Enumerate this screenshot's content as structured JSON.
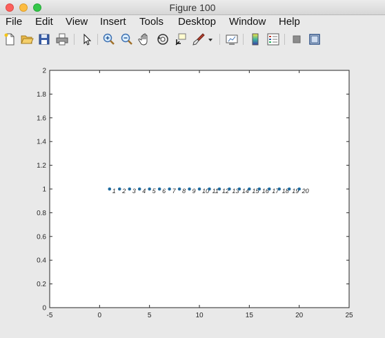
{
  "window": {
    "title": "Figure 100"
  },
  "menu": {
    "items": [
      "File",
      "Edit",
      "View",
      "Insert",
      "Tools",
      "Desktop",
      "Window",
      "Help"
    ]
  },
  "toolbar": {
    "icons": [
      "new-figure-icon",
      "open-file-icon",
      "save-icon",
      "print-icon",
      "pointer-icon",
      "zoom-in-icon",
      "zoom-out-icon",
      "pan-icon",
      "rotate-3d-icon",
      "data-cursor-icon",
      "brush-icon",
      "brush-dropdown-icon",
      "link-plot-icon",
      "colorbar-icon",
      "legend-icon",
      "hide-plot-tools-icon",
      "show-plot-tools-icon"
    ]
  },
  "colors": {
    "marker": "#1f6ba0",
    "axes_background": "#ffffff",
    "figure_background": "#e9e9e9"
  },
  "chart_data": {
    "type": "scatter",
    "title": "",
    "xlabel": "",
    "ylabel": "",
    "xlim": [
      -5,
      25
    ],
    "ylim": [
      0,
      2
    ],
    "xticks": [
      "-5",
      "0",
      "5",
      "10",
      "15",
      "20",
      "25"
    ],
    "yticks": [
      "0",
      "0.2",
      "0.4",
      "0.6",
      "0.8",
      "1",
      "1.2",
      "1.4",
      "1.6",
      "1.8",
      "2"
    ],
    "grid": false,
    "x": [
      1,
      2,
      3,
      4,
      5,
      6,
      7,
      8,
      9,
      10,
      11,
      12,
      13,
      14,
      15,
      16,
      17,
      18,
      19,
      20
    ],
    "y": [
      1,
      1,
      1,
      1,
      1,
      1,
      1,
      1,
      1,
      1,
      1,
      1,
      1,
      1,
      1,
      1,
      1,
      1,
      1,
      1
    ],
    "point_labels": [
      "1",
      "2",
      "3",
      "4",
      "5",
      "6",
      "7",
      "8",
      "9",
      "10",
      "11",
      "12",
      "13",
      "14",
      "15",
      "16",
      "17",
      "18",
      "19",
      "20"
    ]
  }
}
